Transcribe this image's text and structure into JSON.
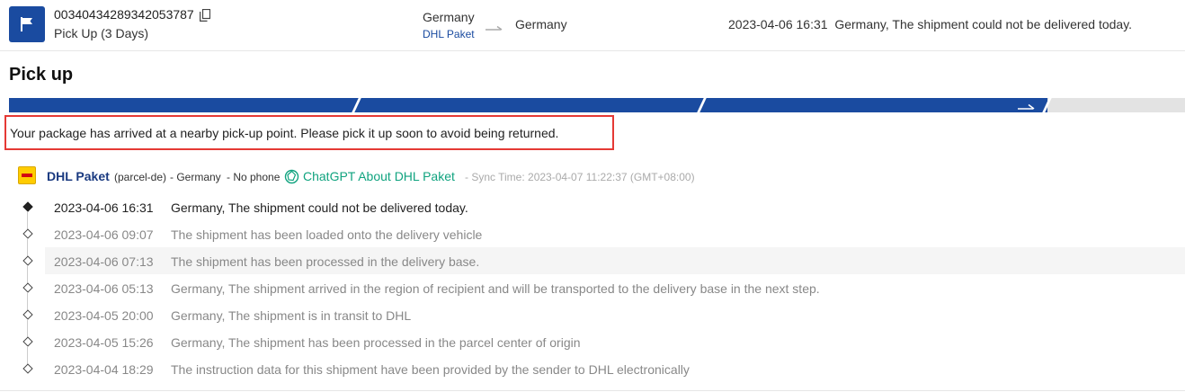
{
  "header": {
    "tracking_number": "00340434289342053787",
    "status": "Pick Up (3 Days)",
    "origin_country": "Germany",
    "carrier": "DHL Paket",
    "destination_country": "Germany",
    "latest_time": "2023-04-06 16:31",
    "latest_event": "Germany, The shipment could not be delivered today."
  },
  "page_title": "Pick up",
  "progress": {
    "completed_steps": 3,
    "total_steps": 4,
    "accent": "#1a4ba0"
  },
  "notice": "Your package has arrived at a nearby pick-up point. Please pick it up soon to avoid being returned.",
  "carrier_info": {
    "name": "DHL Paket",
    "code": "(parcel-de)",
    "country": "- Germany",
    "phone": "- No phone",
    "gpt_label": "ChatGPT About DHL Paket",
    "sync_time": "- Sync Time: 2023-04-07 11:22:37 (GMT+08:00)"
  },
  "events": [
    {
      "time": "2023-04-06 16:31",
      "desc": "Germany, The shipment could not be delivered today."
    },
    {
      "time": "2023-04-06 09:07",
      "desc": "The shipment has been loaded onto the delivery vehicle"
    },
    {
      "time": "2023-04-06 07:13",
      "desc": "The shipment has been processed in the delivery base."
    },
    {
      "time": "2023-04-06 05:13",
      "desc": "Germany, The shipment arrived in the region of recipient and will be transported to the delivery base in the next step."
    },
    {
      "time": "2023-04-05 20:00",
      "desc": "Germany, The shipment is in transit to DHL"
    },
    {
      "time": "2023-04-05 15:26",
      "desc": "Germany, The shipment has been processed in the parcel center of origin"
    },
    {
      "time": "2023-04-04 18:29",
      "desc": "The instruction data for this shipment have been provided by the sender to DHL electronically"
    }
  ]
}
